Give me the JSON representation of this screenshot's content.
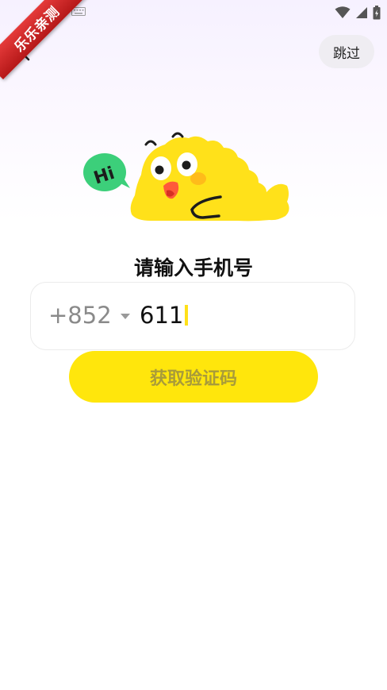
{
  "status_bar": {
    "icons": [
      "keyboard-icon",
      "wifi-icon",
      "signal-icon",
      "battery-icon"
    ]
  },
  "ribbon": {
    "text": "乐乐亲测"
  },
  "header": {
    "back_icon": "back-arrow-icon",
    "skip_label": "跳过"
  },
  "mascot": {
    "speech_text": "Hi"
  },
  "main": {
    "title": "请输入手机号",
    "country_code": "+852",
    "phone_value": "611",
    "submit_label": "获取验证码"
  },
  "colors": {
    "accent": "#ffe60c",
    "bubble": "#3ccf7a",
    "ribbon": "#d42a2a",
    "button_text": "#a89b3a"
  }
}
